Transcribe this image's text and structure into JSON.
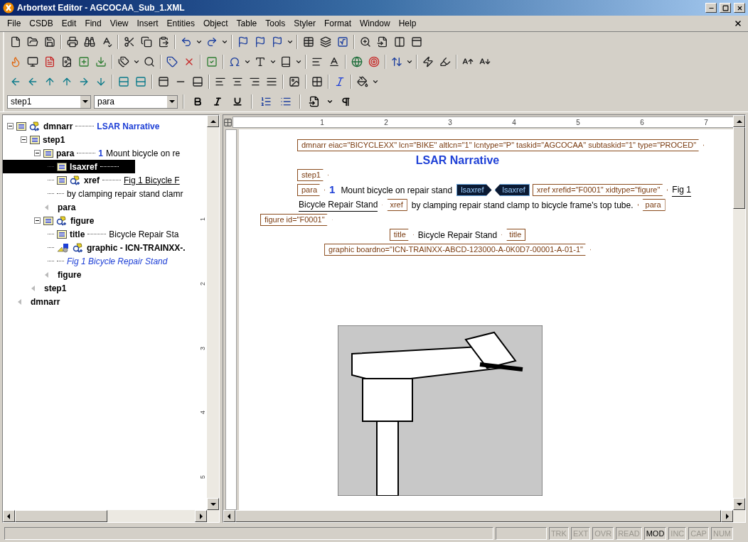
{
  "window": {
    "title": "Arbortext Editor - AGCOCAA_Sub_1.XML"
  },
  "menu": [
    "File",
    "CSDB",
    "Edit",
    "Find",
    "View",
    "Insert",
    "Entities",
    "Object",
    "Table",
    "Tools",
    "Styler",
    "Format",
    "Window",
    "Help"
  ],
  "format_bar": {
    "element_select": "step1",
    "style_select": "para"
  },
  "tree": [
    {
      "label": "dmnarr",
      "kind": "element",
      "linked": true,
      "content": {
        "kind": "title",
        "text": "LSAR Narrative"
      },
      "expanded": true,
      "selected": false,
      "children": [
        {
          "label": "step1",
          "kind": "element",
          "linked": false,
          "expanded": true,
          "selected": false,
          "children": [
            {
              "label": "para",
              "kind": "element",
              "linked": false,
              "number": "1",
              "content": {
                "kind": "plain",
                "text": "Mount bicycle on re"
              },
              "expanded": true,
              "selected": false,
              "children": [
                {
                  "label": "lsaxref",
                  "kind": "element",
                  "linked": false,
                  "content": {
                    "kind": "empty"
                  },
                  "selected": true
                },
                {
                  "label": "xref",
                  "kind": "element",
                  "linked": true,
                  "content": {
                    "kind": "link",
                    "text": "Fig 1  Bicycle F"
                  },
                  "selected": false
                },
                {
                  "label": "by clamping repair stand clamr",
                  "kind": "text",
                  "selected": false
                },
                {
                  "label": "para",
                  "kind": "end",
                  "selected": false
                }
              ]
            },
            {
              "label": "figure",
              "kind": "element",
              "linked": true,
              "expanded": true,
              "selected": false,
              "children": [
                {
                  "label": "title",
                  "kind": "element",
                  "linked": false,
                  "content": {
                    "kind": "plain",
                    "text": "Bicycle Repair Sta"
                  },
                  "selected": false
                },
                {
                  "label": "graphic - ICN-TRAINXX-.",
                  "kind": "graphic",
                  "linked": true,
                  "selected": false
                },
                {
                  "label": "Fig 1  Bicycle Repair Stand",
                  "kind": "caption",
                  "selected": false
                },
                {
                  "label": "figure",
                  "kind": "end",
                  "selected": false
                }
              ]
            },
            {
              "label": "step1",
              "kind": "end",
              "selected": false
            }
          ]
        },
        {
          "label": "dmnarr",
          "kind": "end",
          "selected": false
        }
      ]
    }
  ],
  "ruler": {
    "labels": [
      "1",
      "2",
      "3",
      "4",
      "5",
      "6",
      "7"
    ]
  },
  "vertical_ruler": {
    "labels": [
      "1",
      "2",
      "3",
      "4",
      "5"
    ]
  },
  "document": [
    {
      "kind": "indented",
      "segments": [
        {
          "kind": "start_tag",
          "text": "dmnarr eiac=\"BICYCLEXX\" lcn=\"BIKE\" altlcn=\"1\" lcntype=\"P\" taskid=\"AGCOCAA\" subtaskid=\"1\" type=\"PROCED\"",
          "selected": false
        }
      ]
    },
    {
      "kind": "centered",
      "segments": [
        {
          "kind": "heading",
          "text": "LSAR Narrative"
        }
      ]
    },
    {
      "kind": "indented",
      "segments": [
        {
          "kind": "start_tag",
          "text": "step1",
          "selected": false
        }
      ]
    },
    {
      "kind": "indented",
      "segments": [
        {
          "kind": "start_tag",
          "text": "para",
          "selected": false
        },
        {
          "kind": "number",
          "text": "1"
        },
        {
          "kind": "text",
          "text": "Mount bicycle on repair stand"
        },
        {
          "kind": "start_tag",
          "text": "lsaxref",
          "selected": true
        },
        {
          "kind": "end_tag",
          "text": "lsaxref",
          "selected": true
        },
        {
          "kind": "start_tag",
          "text": "xref xrefid=\"F0001\" xidtype=\"figure\"",
          "selected": false
        },
        {
          "kind": "link",
          "text": "Fig 1"
        }
      ]
    },
    {
      "kind": "indented",
      "segments": [
        {
          "kind": "link",
          "text": "Bicycle Repair Stand"
        },
        {
          "kind": "end_tag",
          "text": "xref",
          "selected": false
        },
        {
          "kind": "text",
          "text": "by clamping repair stand clamp to bicycle frame's top tube."
        },
        {
          "kind": "end_tag",
          "text": "para",
          "selected": false
        }
      ]
    },
    {
      "kind": "outdented",
      "segments": [
        {
          "kind": "start_tag",
          "text": "figure id=\"F0001\"",
          "selected": false
        }
      ]
    },
    {
      "kind": "centered",
      "segments": [
        {
          "kind": "start_tag",
          "text": "title",
          "selected": false
        },
        {
          "kind": "text",
          "text": "Bicycle Repair Stand"
        },
        {
          "kind": "end_tag",
          "text": "title",
          "selected": false
        }
      ]
    },
    {
      "kind": "centered",
      "segments": [
        {
          "kind": "start_tag",
          "text": "graphic boardno=\"ICN-TRAINXX-ABCD-123000-A-0K0D7-00001-A-01-1\"",
          "selected": false
        }
      ]
    }
  ],
  "status_bar": {
    "indicators": [
      {
        "label": "TRK",
        "on": false
      },
      {
        "label": "EXT",
        "on": false
      },
      {
        "label": "OVR",
        "on": false
      },
      {
        "label": "READ",
        "on": false
      },
      {
        "label": "MOD",
        "on": true
      },
      {
        "label": "INC",
        "on": false
      },
      {
        "label": "CAP",
        "on": false
      },
      {
        "label": "NUM",
        "on": false
      }
    ]
  }
}
